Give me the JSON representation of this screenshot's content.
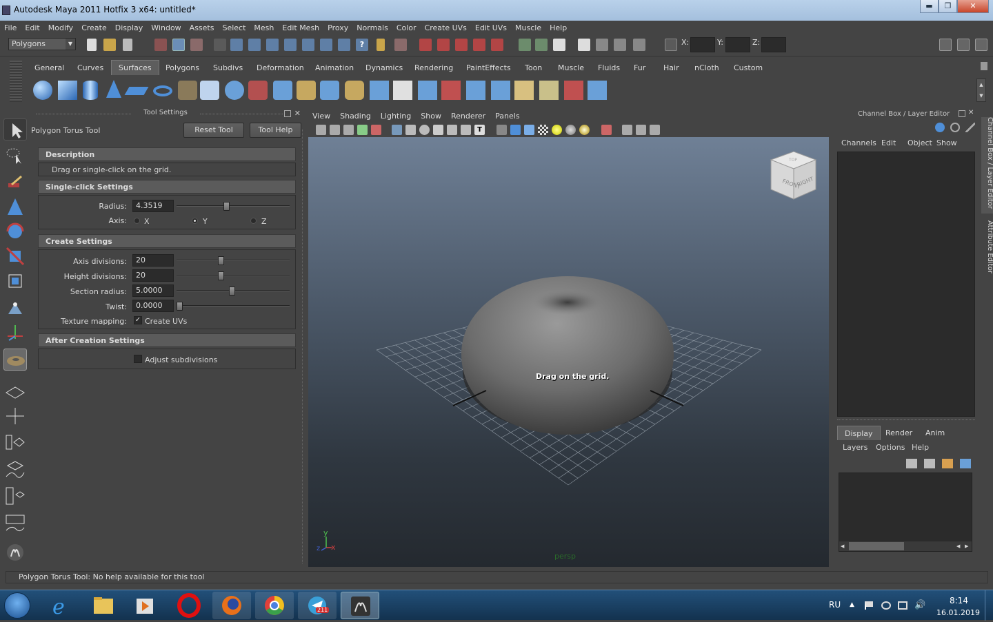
{
  "window": {
    "title": "Autodesk Maya 2011 Hotfix 3 x64: untitled*",
    "minimize": "▬",
    "maximize": "❐",
    "close": "✕"
  },
  "menu": [
    "File",
    "Edit",
    "Modify",
    "Create",
    "Display",
    "Window",
    "Assets",
    "Select",
    "Mesh",
    "Edit Mesh",
    "Proxy",
    "Normals",
    "Color",
    "Create UVs",
    "Edit UVs",
    "Muscle",
    "Help"
  ],
  "status_line": {
    "mode": "Polygons",
    "x_label": "X:",
    "y_label": "Y:",
    "z_label": "Z:"
  },
  "shelf_tabs": [
    "General",
    "Curves",
    "Surfaces",
    "Polygons",
    "Subdivs",
    "Deformation",
    "Animation",
    "Dynamics",
    "Rendering",
    "PaintEffects",
    "Toon",
    "Muscle",
    "Fluids",
    "Fur",
    "Hair",
    "nCloth",
    "Custom"
  ],
  "shelf_active": "Surfaces",
  "tool_settings": {
    "header": "Tool Settings",
    "tool_name": "Polygon Torus Tool",
    "reset_button": "Reset Tool",
    "help_button": "Tool Help",
    "description_header": "Description",
    "description_text": "Drag or single-click on the grid.",
    "single_click_header": "Single-click Settings",
    "radius_label": "Radius:",
    "radius_value": "4.3519",
    "radius_slider": 0.44,
    "axis_label": "Axis:",
    "axis_x": "X",
    "axis_y": "Y",
    "axis_z": "Z",
    "axis_selected": "Y",
    "create_header": "Create Settings",
    "axis_div_label": "Axis divisions:",
    "axis_div_value": "20",
    "axis_div_slider": 0.39,
    "height_div_label": "Height divisions:",
    "height_div_value": "20",
    "height_div_slider": 0.39,
    "section_radius_label": "Section radius:",
    "section_radius_value": "5.0000",
    "section_radius_slider": 0.49,
    "twist_label": "Twist:",
    "twist_value": "0.0000",
    "twist_slider": 0.0,
    "texture_label": "Texture mapping:",
    "create_uvs_label": "Create UVs",
    "create_uvs_checked": "✓",
    "after_header": "After Creation Settings",
    "adjust_label": "Adjust subdivisions"
  },
  "viewport": {
    "menu": [
      "View",
      "Shading",
      "Lighting",
      "Show",
      "Renderer",
      "Panels"
    ],
    "overlay": "Drag on the grid.",
    "camera": "persp",
    "cube_front": "FRONT",
    "cube_right": "RIGHT",
    "cube_top": "TOP",
    "axis_x": "x",
    "axis_y": "y",
    "axis_z": "z"
  },
  "channel_box": {
    "header": "Channel Box / Layer Editor",
    "menu": [
      "Channels",
      "Edit",
      "Object",
      "Show"
    ],
    "layer_tabs": [
      "Display",
      "Render",
      "Anim"
    ],
    "layer_menu": [
      "Layers",
      "Options",
      "Help"
    ]
  },
  "right_rail": {
    "channel_tab": "Channel Box / Layer Editor",
    "attr_tab": "Attribute Editor"
  },
  "help_line": "Polygon Torus Tool: No help available for this tool",
  "taskbar": {
    "lang": "RU",
    "time": "8:14",
    "date": "16.01.2019",
    "telegram_badge": "211"
  },
  "colors": {
    "accent": "#5d5d5d",
    "panel": "#444444",
    "field": "#2b2b2b",
    "taskbar": "#1b3d60"
  }
}
